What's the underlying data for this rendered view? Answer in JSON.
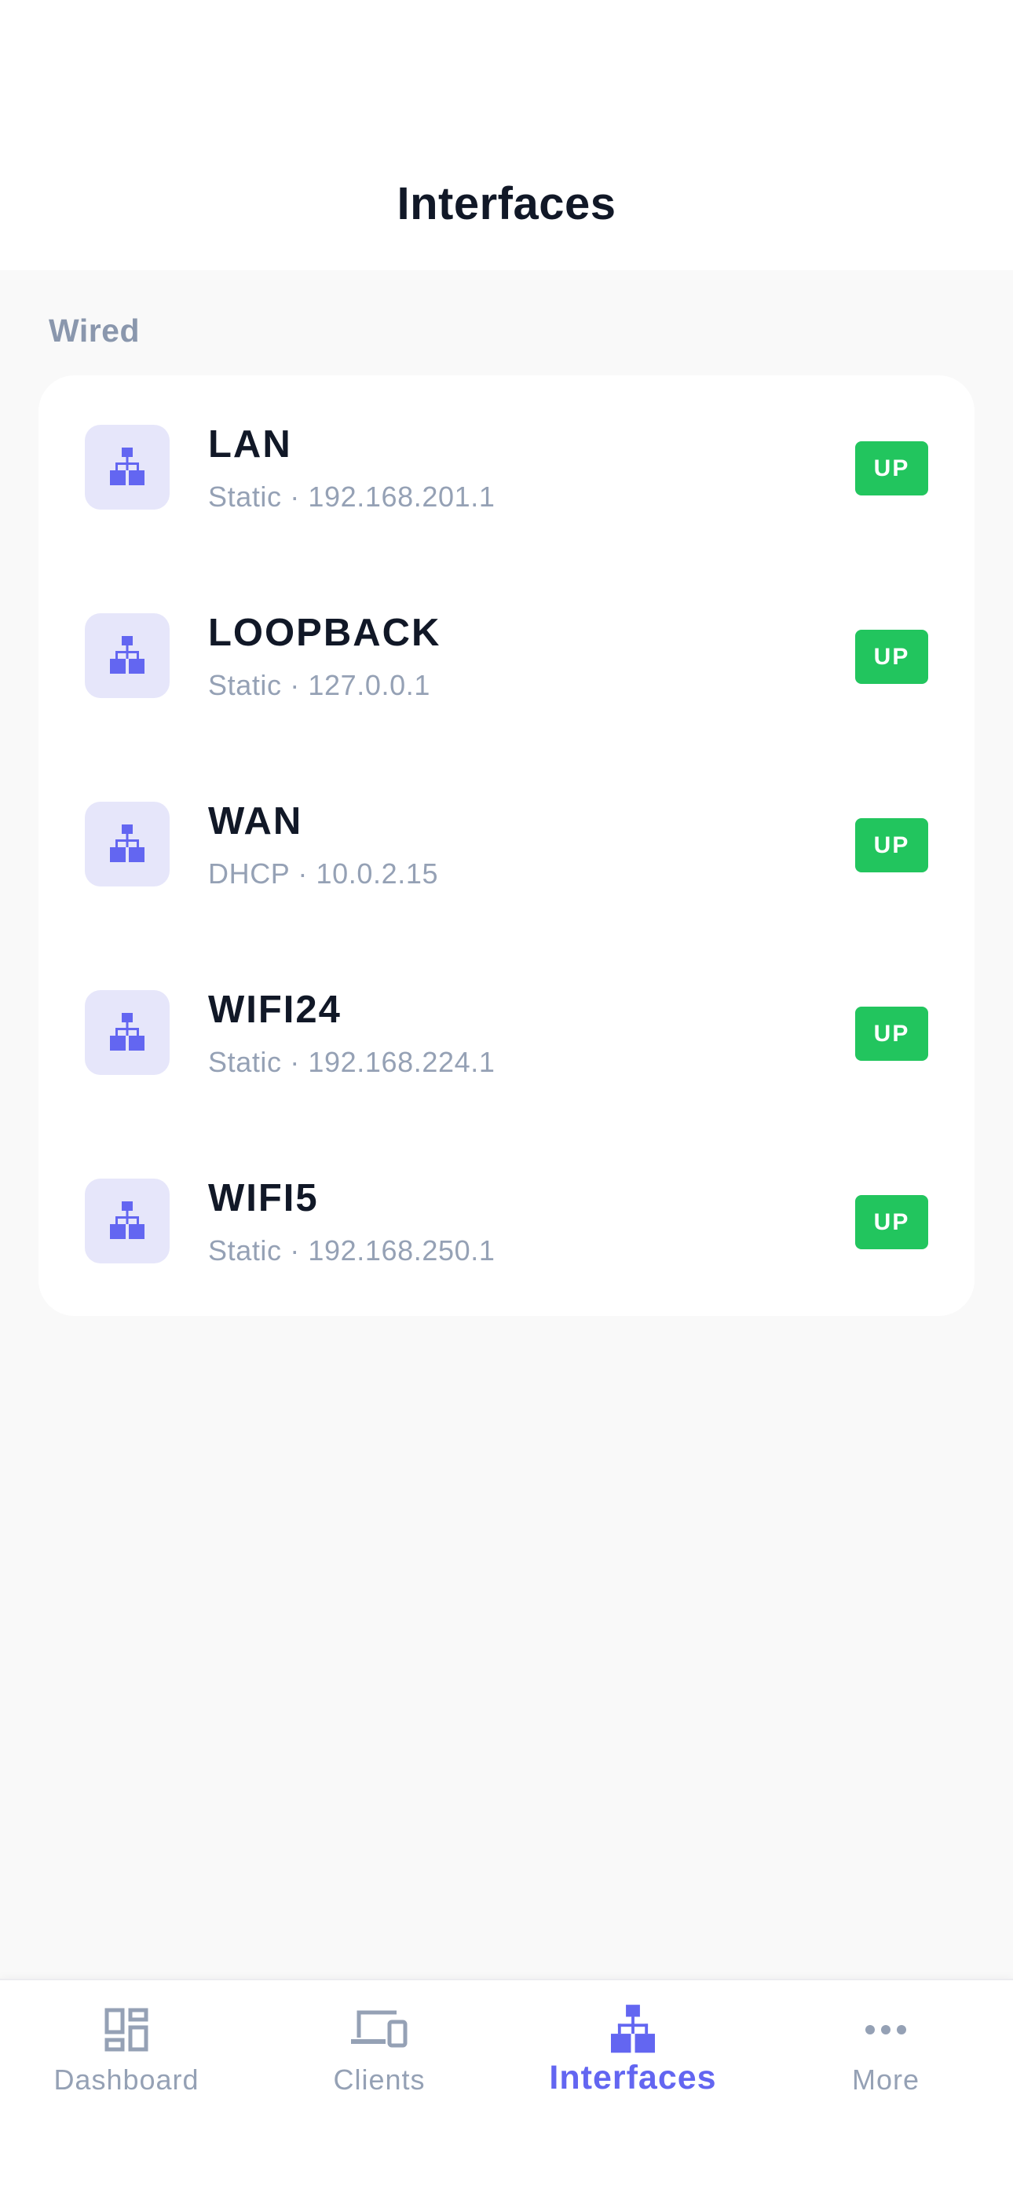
{
  "header": {
    "title": "Interfaces"
  },
  "section": {
    "title": "Wired"
  },
  "interfaces": [
    {
      "name": "LAN",
      "detail": "Static · 192.168.201.1",
      "status": "UP"
    },
    {
      "name": "LOOPBACK",
      "detail": "Static · 127.0.0.1",
      "status": "UP"
    },
    {
      "name": "WAN",
      "detail": "DHCP · 10.0.2.15",
      "status": "UP"
    },
    {
      "name": "WIFI24",
      "detail": "Static · 192.168.224.1",
      "status": "UP"
    },
    {
      "name": "WIFI5",
      "detail": "Static · 192.168.250.1",
      "status": "UP"
    }
  ],
  "tabbar": {
    "items": [
      {
        "label": "Dashboard",
        "icon": "dashboard-icon"
      },
      {
        "label": "Clients",
        "icon": "devices-icon"
      },
      {
        "label": "Interfaces",
        "icon": "network-icon",
        "active": true
      },
      {
        "label": "More",
        "icon": "more-icon"
      }
    ]
  },
  "colors": {
    "accent": "#6366f1",
    "status_up": "#22c55e",
    "muted": "#95a1b5",
    "icon_bg": "#e6e6fa"
  }
}
